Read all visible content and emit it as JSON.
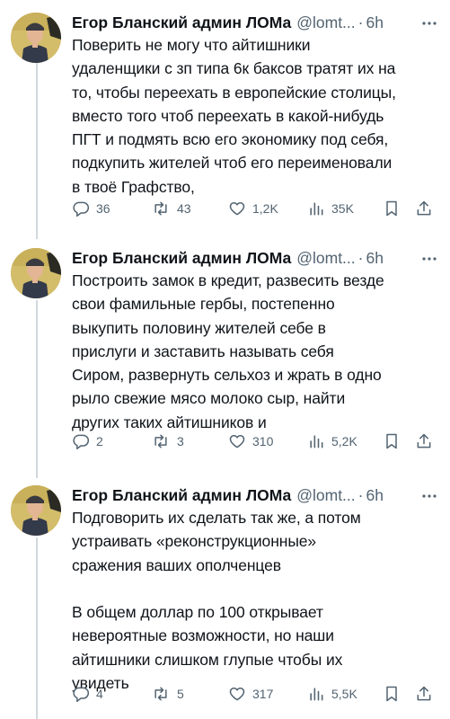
{
  "tweets": [
    {
      "author": {
        "name": "Егор Бланский админ ЛОМа",
        "handle": "@lomt...",
        "time": "6h",
        "dot": "·"
      },
      "text": "Поверить не могу что айтишники\nудаленщики с зп типа 6к баксов тратят их на\nто, чтобы переехать в европейские столицы,\nвместо того чтоб переехать в какой-нибудь\nПГТ и подмять всю его экономику под себя,\nподкупить жителей чтоб его переименовали\nв твоё Графство,",
      "stats": {
        "replies": "36",
        "retweets": "43",
        "likes": "1,2K",
        "views": "35K"
      }
    },
    {
      "author": {
        "name": "Егор Бланский админ ЛОМа",
        "handle": "@lomt...",
        "time": "6h",
        "dot": "·"
      },
      "text": "Построить замок в кредит, развесить везде\nсвои фамильные гербы, постепенно\nвыкупить половину жителей себе в\nприслуги и заставить называть себя\nСиром, развернуть сельхоз и жрать в одно\nрыло свежие мясо молоко сыр, найти\nдругих таких айтишников и",
      "stats": {
        "replies": "2",
        "retweets": "3",
        "likes": "310",
        "views": "5,2K"
      }
    },
    {
      "author": {
        "name": "Егор Бланский админ ЛОМа",
        "handle": "@lomt...",
        "time": "6h",
        "dot": "·"
      },
      "text": "Подговорить их сделать так же, а потом\nустраивать «реконструкционные»\nсражения ваших ополченцев\n\nВ общем доллар по 100 открывает\nневероятные возможности, но наши\nайтишники слишком глупые чтобы их\nувидеть",
      "stats": {
        "replies": "4",
        "retweets": "5",
        "likes": "317",
        "views": "5,5K"
      }
    }
  ],
  "icons": {
    "reply": "reply-icon",
    "retweet": "retweet-icon",
    "like": "heart-icon",
    "views": "views-icon",
    "bookmark": "bookmark-icon",
    "share": "share-icon",
    "more": "more-icon"
  },
  "colors": {
    "text": "#0f1419",
    "secondary": "#536471",
    "thread_line": "#cfd9de",
    "background": "#ffffff"
  }
}
